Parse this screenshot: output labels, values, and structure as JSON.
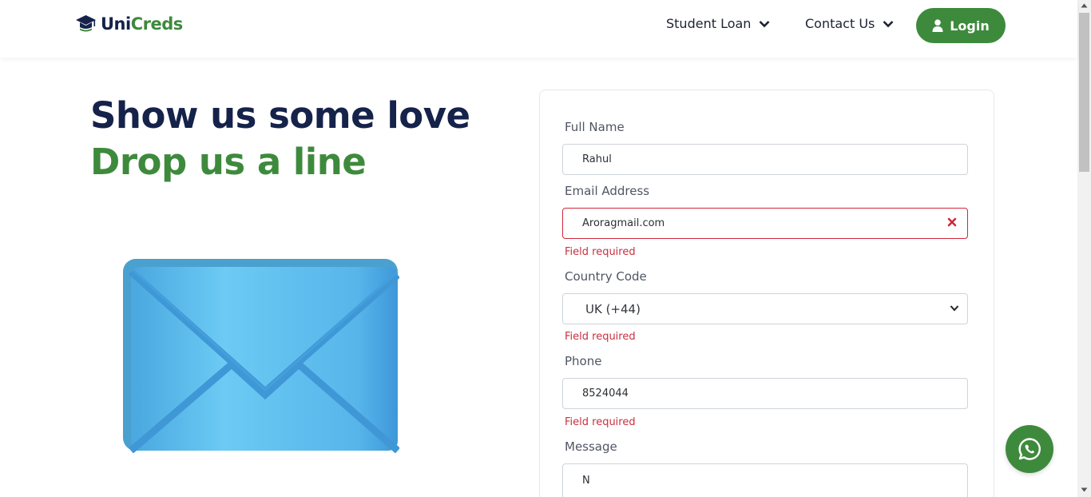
{
  "brand": {
    "part1": "Uni",
    "part2": "Creds"
  },
  "nav": {
    "student_loan": "Student Loan",
    "contact_us": "Contact Us",
    "login": "Login"
  },
  "hero": {
    "line1": "Show us some love",
    "line2": "Drop us a line"
  },
  "form": {
    "full_name_label": "Full Name",
    "full_name_value": "Rahul",
    "email_label": "Email Address",
    "email_value": "Aroragmail.com",
    "email_error": "Field required",
    "country_label": "Country Code",
    "country_value": "UK (+44)",
    "country_error": "Field required",
    "phone_label": "Phone",
    "phone_value": "8524044",
    "phone_error": "Field required",
    "message_label": "Message",
    "message_value": "N"
  },
  "colors": {
    "brand_green": "#3e8a3d",
    "brand_navy": "#15224a",
    "error_red": "#c9303e"
  },
  "icons": {
    "logo": "graduation-cap-icon",
    "dropdown": "chevron-down-icon",
    "login": "user-icon",
    "error": "close-icon",
    "chat": "whatsapp-icon",
    "illustration": "envelope-icon"
  }
}
